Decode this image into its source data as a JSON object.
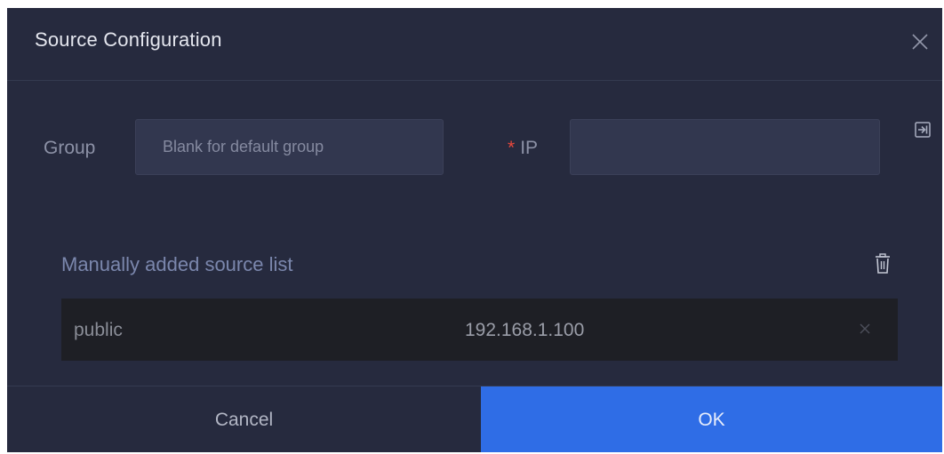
{
  "dialog": {
    "title": "Source Configuration",
    "close_icon": "close-icon"
  },
  "form": {
    "group_label": "Group",
    "group_placeholder": "Blank for default group",
    "group_value": "",
    "ip_required_mark": "*",
    "ip_label": "IP",
    "ip_value": "",
    "import_icon": "import-icon"
  },
  "source_list": {
    "title": "Manually added source list",
    "delete_all_icon": "trash-icon",
    "rows": [
      {
        "name": "public",
        "ip": "192.168.1.100",
        "remove_icon": "close-icon"
      }
    ]
  },
  "footer": {
    "cancel_label": "Cancel",
    "ok_label": "OK"
  },
  "colors": {
    "dialog_bg": "#262a3e",
    "input_bg": "#32374f",
    "row_bg": "#1e1f25",
    "primary": "#2f6de6",
    "required": "#e8483c",
    "list_title": "#7b87ad"
  }
}
